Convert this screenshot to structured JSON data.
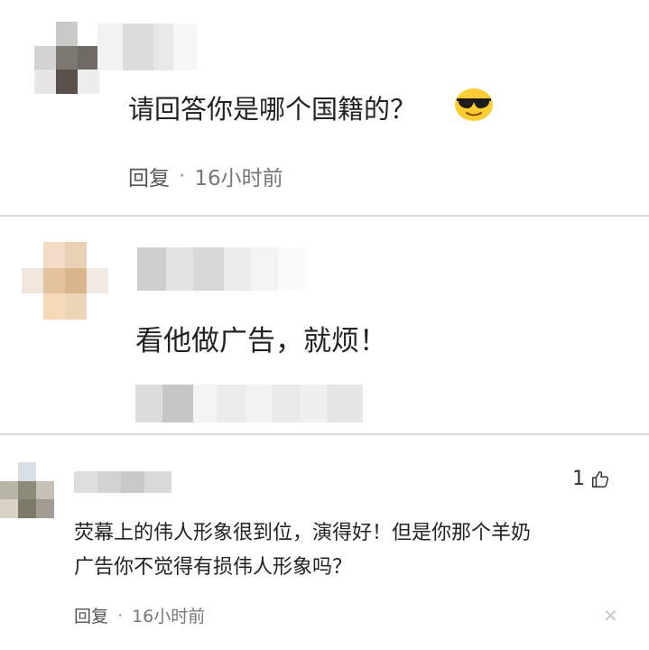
{
  "comments": [
    {
      "text": "请回答你是哪个国籍的？",
      "emoji": "sunglasses-face",
      "reply_label": "回复",
      "separator": "·",
      "time": "16小时前"
    },
    {
      "text": "看他做广告，就烦！"
    },
    {
      "text_line1": "荧幕上的伟人形象很到位，演得好！但是你那个羊奶",
      "text_line2": "广告你不觉得有损伟人形象吗？",
      "like_count": "1",
      "like_icon": "thumbs-up-icon",
      "reply_label": "回复",
      "separator": "·",
      "time": "16小时前",
      "close_icon": "close-icon"
    }
  ],
  "colors": {
    "divider": "#d6d6d6",
    "meta_text": "#777777",
    "body_text": "#222222"
  }
}
